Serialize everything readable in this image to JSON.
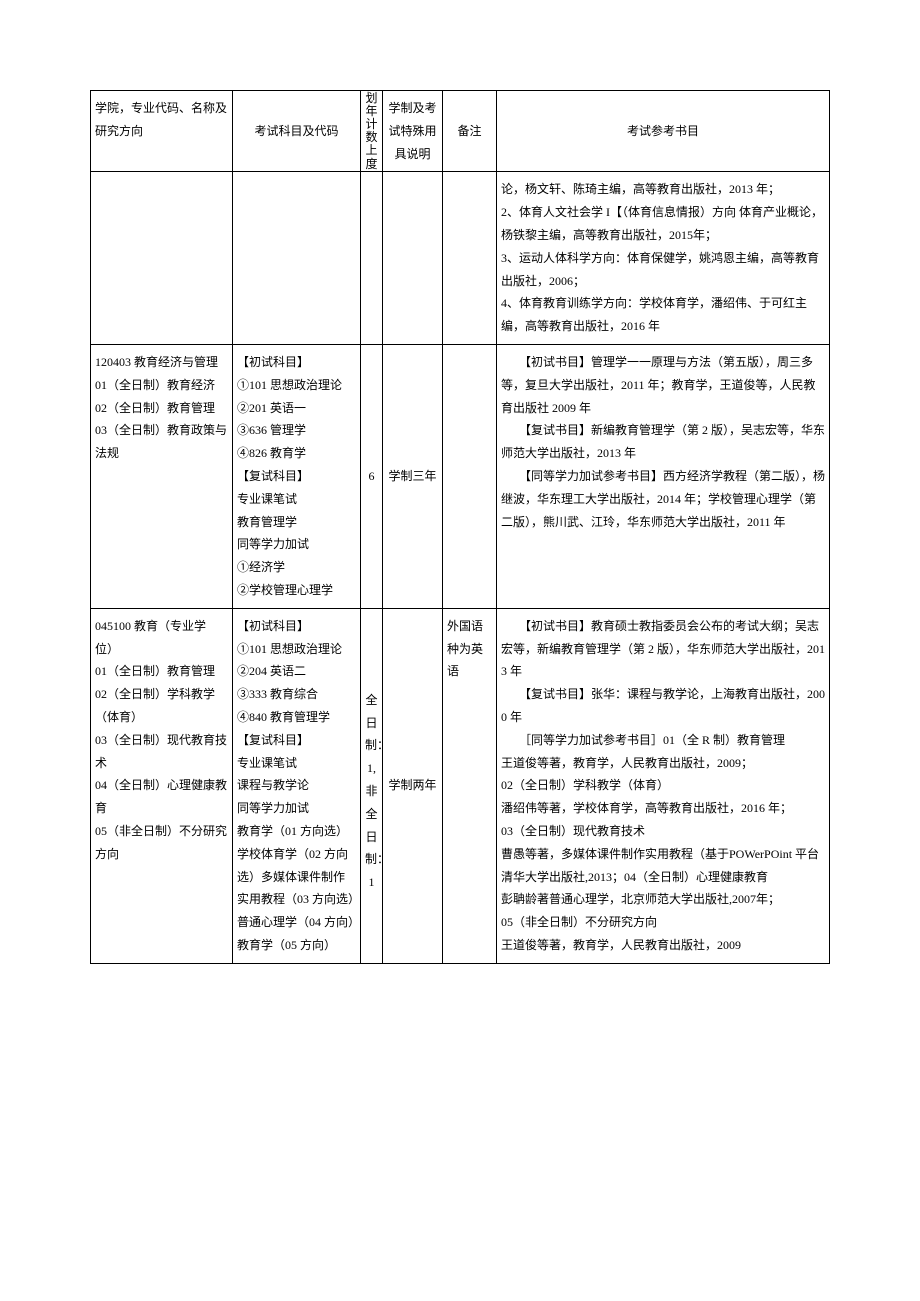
{
  "header": {
    "col1": "学院，专业代码、名称及研究方向",
    "col2": "考试科目及代码",
    "col3": "划年计数上度",
    "col4": "学制及考试特殊用具说明",
    "col5": "备注",
    "col6": "考试参考书目"
  },
  "row1": {
    "books": "论，杨文轩、陈琦主编，高等教育出版社，2013 年；\n2、体育人文社会学 I【（体育信息情报）方向 体育产业概论，杨铁黎主编，高等教育出版社，2015年；\n3、运动人体科学方向：体育保健学，姚鸿恩主编，高等教育出版社，2006；\n4、体育教育训练学方向：学校体育学，潘绍伟、于可红主编，高等教育出版社，2016 年"
  },
  "row2": {
    "program": "120403 教育经济与管理\n01（全日制）教育经济\n02（全日制）教育管理\n03（全日制）教育政策与法规",
    "subjects": "【初试科目】\n①101 思想政治理论\n②201 英语一\n③636 管理学\n④826 教育学\n【复试科目】\n专业课笔试\n教育管理学\n同等学力加试\n①经济学\n②学校管理心理学",
    "count": "6",
    "duration": "学制三年",
    "notes": "",
    "books": "　　【初试书目】管理学一一原理与方法（第五版），周三多等，复旦大学出版社，2011 年；教育学，王道俊等，人民教育出版社 2009 年\n　　【复试书目】新编教育管理学（第 2 版），吴志宏等，华东师范大学出版社，2013 年\n　　【同等学力加试参考书目】西方经济学教程（第二版），杨继波，华东理工大学出版社，2014 年；学校管理心理学（第二版），熊川武、江玲，华东师范大学出版社，2011 年"
  },
  "row3": {
    "program": "045100 教育（专业学位）\n01（全日制）教育管理\n02（全日制）学科教学（体育）\n03（全日制）现代教育技术\n04（全日制）心理健康教育\n05（非全日制）不分研究方向",
    "subjects": "【初试科目】\n①101 思想政治理论\n②204 英语二\n③333 教育综合\n④840 教育管理学\n【复试科目】\n专业课笔试\n课程与教学论\n同等学力加试\n教育学（01 方向选）学校体育学（02 方向选）多媒体课件制作实用教程（03 方向选）普通心理学（04 方向）教育学（05 方向）",
    "count": "全日制：1, 非全日制：1",
    "duration": "学制两年",
    "notes": "外国语种为英语",
    "books": "　　【初试书目】教育硕士教指委员会公布的考试大纲；吴志宏等，新编教育管理学（第 2 版），华东师范大学出版社，2013 年\n　　【复试书目】张华：课程与教学论，上海教育出版社，2000 年\n　　［同等学力加试参考书目］01（全 R 制）教育管理\n王道俊等著，教育学，人民教育出版社，2009；\n02（全日制）学科教学（体育）\n潘绍伟等著，学校体育学，高等教育出版社，2016 年；\n03（全日制）现代教育技术\n曹愚等著，多媒体课件制作实用教程（基于POWerPOint 平台清华大学出版社,2013；04（全日制）心理健康教育\n彭聃龄著普通心理学，北京师范大学出版社,2007年；\n05（非全日制）不分研究方向\n王道俊等著，教育学，人民教育出版社，2009"
  }
}
